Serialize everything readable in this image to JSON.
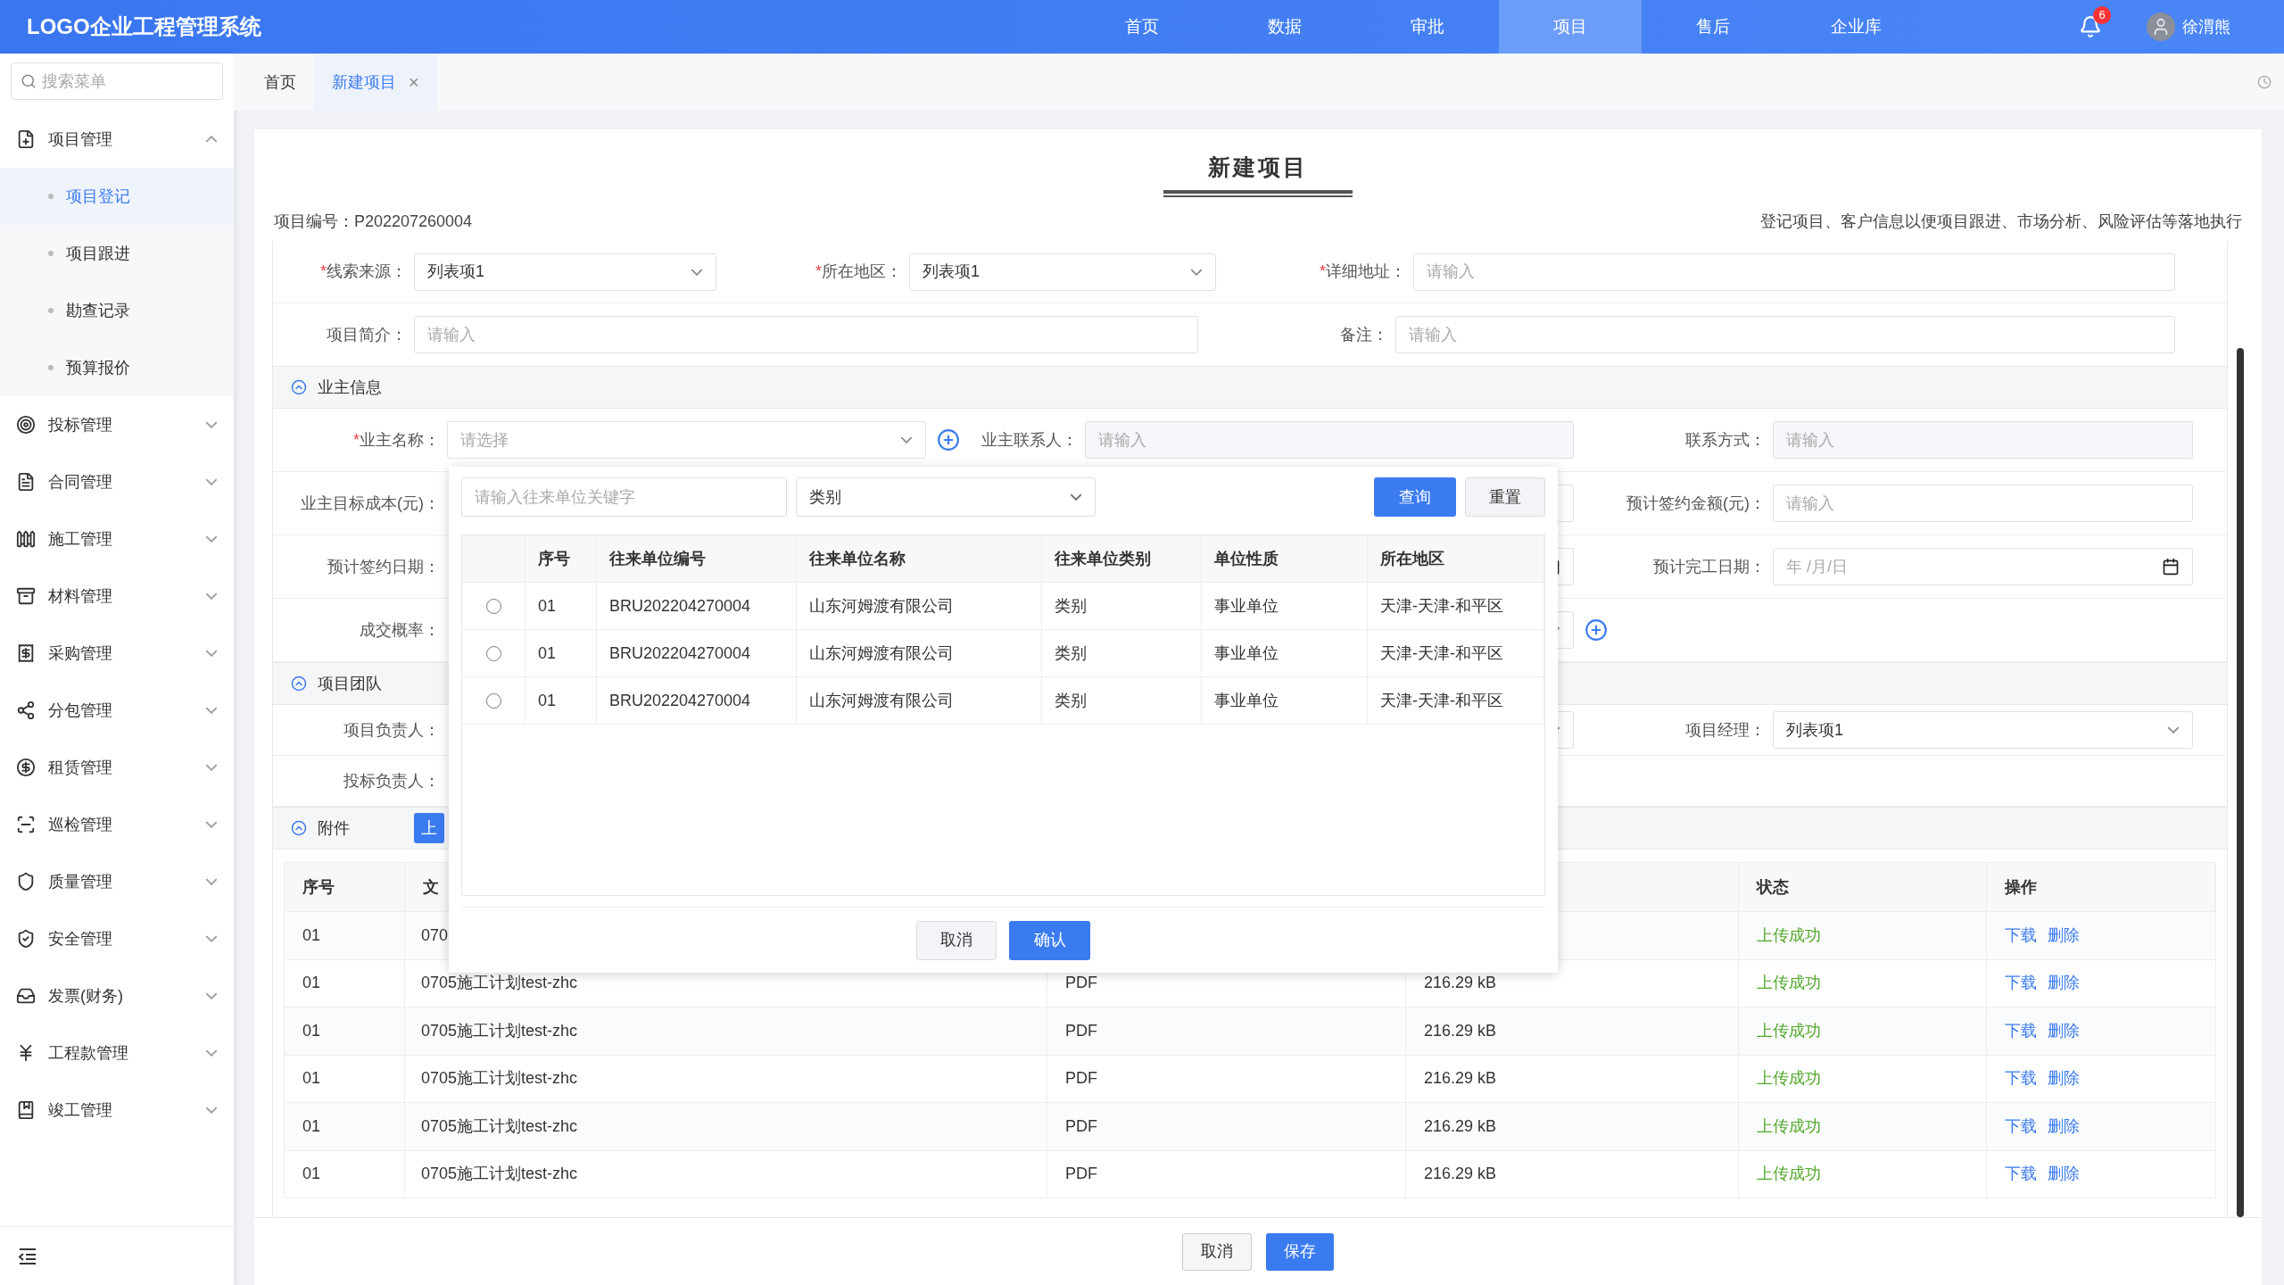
{
  "header": {
    "logo": "LOGO企业工程管理系统",
    "nav": [
      {
        "label": "首页",
        "selected": false
      },
      {
        "label": "数据",
        "selected": false
      },
      {
        "label": "审批",
        "selected": false
      },
      {
        "label": "项目",
        "selected": true
      },
      {
        "label": "售后",
        "selected": false
      },
      {
        "label": "企业库",
        "selected": false
      }
    ],
    "notifications": "6",
    "user": "徐渭熊"
  },
  "sidebar": {
    "search_placeholder": "搜索菜单",
    "menu": [
      {
        "label": "项目管理",
        "expanded": true,
        "children": [
          {
            "label": "项目登记",
            "selected": true
          },
          {
            "label": "项目跟进",
            "selected": false
          },
          {
            "label": "勘查记录",
            "selected": false
          },
          {
            "label": "预算报价",
            "selected": false
          }
        ]
      },
      {
        "label": "投标管理",
        "expanded": false
      },
      {
        "label": "合同管理",
        "expanded": false
      },
      {
        "label": "施工管理",
        "expanded": false
      },
      {
        "label": "材料管理",
        "expanded": false
      },
      {
        "label": "采购管理",
        "expanded": false
      },
      {
        "label": "分包管理",
        "expanded": false
      },
      {
        "label": "租赁管理",
        "expanded": false
      },
      {
        "label": "巡检管理",
        "expanded": false
      },
      {
        "label": "质量管理",
        "expanded": false
      },
      {
        "label": "安全管理",
        "expanded": false
      },
      {
        "label": "发票(财务)",
        "expanded": false
      },
      {
        "label": "工程款管理",
        "expanded": false
      },
      {
        "label": "竣工管理",
        "expanded": false
      }
    ]
  },
  "tabs": [
    {
      "label": "首页",
      "selected": false,
      "closable": false
    },
    {
      "label": "新建项目",
      "selected": true,
      "closable": true
    }
  ],
  "tab_close": "×",
  "page": {
    "title": "新建项目",
    "project_no": "项目编号：P202207260004",
    "description": "登记项目、客户信息以便项目跟进、市场分析、风险评估等落地执行"
  },
  "form": {
    "required_mark": "*",
    "basic_row_1": [
      {
        "label": "线索来源：",
        "required": true,
        "field": {
          "kind": "select",
          "value": "列表项1"
        }
      },
      {
        "label": "所在地区：",
        "required": true,
        "field": {
          "kind": "select",
          "value": "列表项1"
        }
      },
      {
        "label": "详细地址：",
        "required": true,
        "field": {
          "kind": "input",
          "placeholder": "请输入"
        }
      }
    ],
    "basic_row_2": [
      {
        "label": "项目简介：",
        "field": {
          "kind": "input",
          "placeholder": "请输入"
        }
      },
      {
        "label": "备注：",
        "field": {
          "kind": "input",
          "placeholder": "请输入"
        }
      }
    ],
    "owner_section": {
      "title": "业主信息",
      "expanded": true,
      "rows": [
        [
          {
            "label": "业主名称：",
            "required": true,
            "field": {
              "kind": "select",
              "placeholder": "请选择"
            },
            "add": true
          },
          {
            "label": "业主联系人：",
            "field": {
              "kind": "input",
              "placeholder": "请输入",
              "disabled": true
            }
          },
          {
            "label": "联系方式：",
            "field": {
              "kind": "input",
              "placeholder": "请输入",
              "disabled": true
            }
          }
        ],
        [
          {
            "label": "业主目标成本(元)："
          },
          {
            "field": {
              "kind": "input"
            }
          },
          {
            "label": "预计签约金额(元)：",
            "field": {
              "kind": "input",
              "placeholder": "请输入"
            }
          }
        ],
        [
          {
            "label": "预计签约日期："
          },
          {
            "field": {
              "kind": "date"
            }
          },
          {
            "label": "预计完工日期：",
            "field": {
              "kind": "date",
              "placeholder": "年 /月/日"
            }
          }
        ],
        [
          {
            "label": "成交概率："
          },
          {
            "field": {
              "kind": "select"
            },
            "add": true
          },
          {}
        ]
      ]
    },
    "team_section": {
      "title": "项目团队",
      "expanded": true,
      "rows": [
        [
          {
            "label": "项目负责人："
          },
          {
            "field": {
              "kind": "select"
            }
          },
          {
            "label": "项目经理：",
            "field": {
              "kind": "select",
              "value": "列表项1"
            }
          }
        ],
        [
          {
            "label": "投标负责人："
          },
          {},
          {}
        ]
      ]
    },
    "attachment_section": {
      "title": "附件",
      "expanded": true,
      "upload": "上",
      "columns": [
        {
          "label": "序号"
        },
        {
          "label": "文"
        },
        {
          "hidden": true
        },
        {
          "label": "状态"
        },
        {
          "label": "操作"
        }
      ],
      "rows": [
        {
          "no": "01",
          "file": "070",
          "status": "上传成功",
          "actions": [
            "下载",
            "删除"
          ]
        },
        {
          "no": "01",
          "file": "0705施工计划test-zhc",
          "type": "PDF",
          "size": "216.29 kB",
          "status": "上传成功",
          "actions": [
            "下载",
            "删除"
          ]
        },
        {
          "no": "01",
          "file": "0705施工计划test-zhc",
          "type": "PDF",
          "size": "216.29 kB",
          "status": "上传成功",
          "actions": [
            "下载",
            "删除"
          ]
        },
        {
          "no": "01",
          "file": "0705施工计划test-zhc",
          "type": "PDF",
          "size": "216.29 kB",
          "status": "上传成功",
          "actions": [
            "下载",
            "删除"
          ]
        },
        {
          "no": "01",
          "file": "0705施工计划test-zhc",
          "type": "PDF",
          "size": "216.29 kB",
          "status": "上传成功",
          "actions": [
            "下载",
            "删除"
          ]
        },
        {
          "no": "01",
          "file": "0705施工计划test-zhc",
          "type": "PDF",
          "size": "216.29 kB",
          "status": "上传成功",
          "actions": [
            "下载",
            "删除"
          ]
        }
      ]
    }
  },
  "dialog": {
    "search_placeholder": "请输入往来单位关键字",
    "category": "类别",
    "query": "查询",
    "reset": "重置",
    "columns": [
      "序号",
      "往来单位编号",
      "往来单位名称",
      "往来单位类别",
      "单位性质",
      "所在地区"
    ],
    "rows": [
      {
        "selected": false,
        "cells": [
          "01",
          "BRU202204270004",
          "山东河姆渡有限公司",
          "类别",
          "事业单位",
          "天津-天津-和平区"
        ]
      },
      {
        "selected": false,
        "cells": [
          "01",
          "BRU202204270004",
          "山东河姆渡有限公司",
          "类别",
          "事业单位",
          "天津-天津-和平区"
        ]
      },
      {
        "selected": false,
        "cells": [
          "01",
          "BRU202204270004",
          "山东河姆渡有限公司",
          "类别",
          "事业单位",
          "天津-天津-和平区"
        ]
      }
    ],
    "cancel": "取消",
    "confirm": "确认"
  },
  "footer": {
    "cancel": "取消",
    "save": "保存"
  }
}
